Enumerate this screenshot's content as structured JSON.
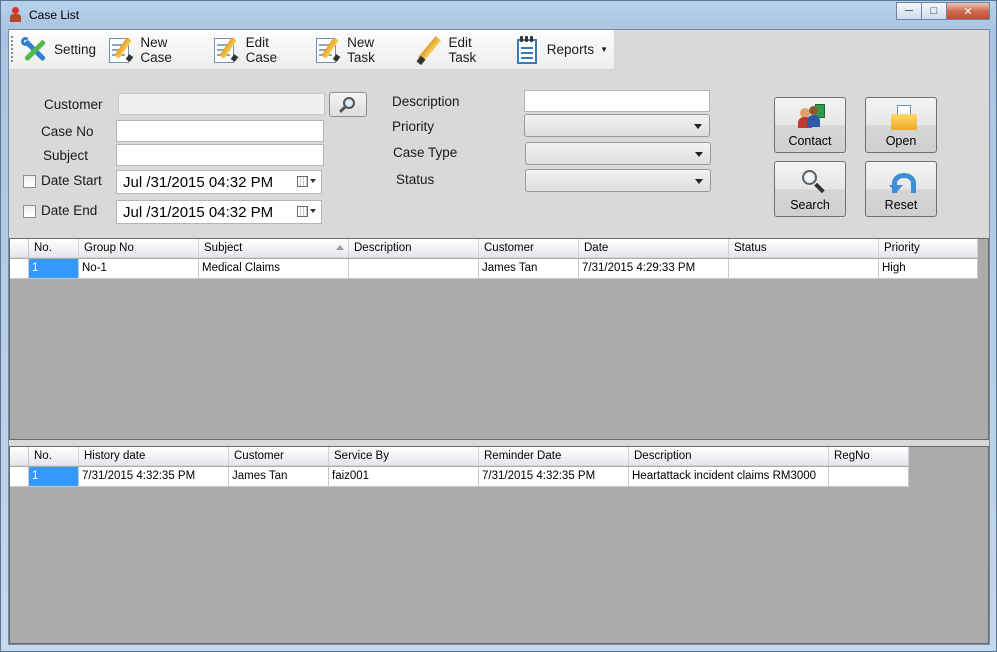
{
  "window": {
    "title": "Case List"
  },
  "toolbar": {
    "items": [
      {
        "label": "Setting",
        "icon": "tools-icon"
      },
      {
        "label": "New Case",
        "icon": "new-case-icon"
      },
      {
        "label": "Edit Case",
        "icon": "edit-case-icon"
      },
      {
        "label": "New Task",
        "icon": "new-task-icon"
      },
      {
        "label": "Edit Task",
        "icon": "pencil-icon"
      },
      {
        "label": "Reports",
        "icon": "notepad-icon"
      }
    ]
  },
  "form": {
    "customer_label": "Customer",
    "customer_value": "",
    "case_no_label": "Case No",
    "case_no_value": "",
    "subject_label": "Subject",
    "subject_value": "",
    "date_start_label": "Date Start",
    "date_start_value": "Jul /31/2015 04:32 PM",
    "date_end_label": "Date End",
    "date_end_value": "Jul /31/2015 04:32 PM",
    "description_label": "Description",
    "description_value": "",
    "priority_label": "Priority",
    "priority_value": "",
    "case_type_label": "Case Type",
    "case_type_value": "",
    "status_label": "Status",
    "status_value": ""
  },
  "actions": {
    "contact": "Contact",
    "open": "Open",
    "search": "Search",
    "reset": "Reset"
  },
  "cases_grid": {
    "columns": [
      "No.",
      "Group No",
      "Subject",
      "Description",
      "Customer",
      "Date",
      "Status",
      "Priority"
    ],
    "rows": [
      [
        "1",
        "No-1",
        "Medical Claims",
        "",
        "James Tan",
        "7/31/2015 4:29:33 PM",
        "",
        "High"
      ]
    ]
  },
  "history_grid": {
    "columns": [
      "No.",
      "History date",
      "Customer",
      "Service By",
      "Reminder Date",
      "Description",
      "RegNo"
    ],
    "rows": [
      [
        "1",
        "7/31/2015 4:32:35 PM",
        "James Tan",
        "faiz001",
        "7/31/2015 4:32:35 PM",
        "Heartattack incident claims RM3000",
        ""
      ]
    ]
  },
  "colors": {
    "selection": "#3399ff",
    "grid_background": "#ababab",
    "form_background": "#d9d9d9"
  }
}
